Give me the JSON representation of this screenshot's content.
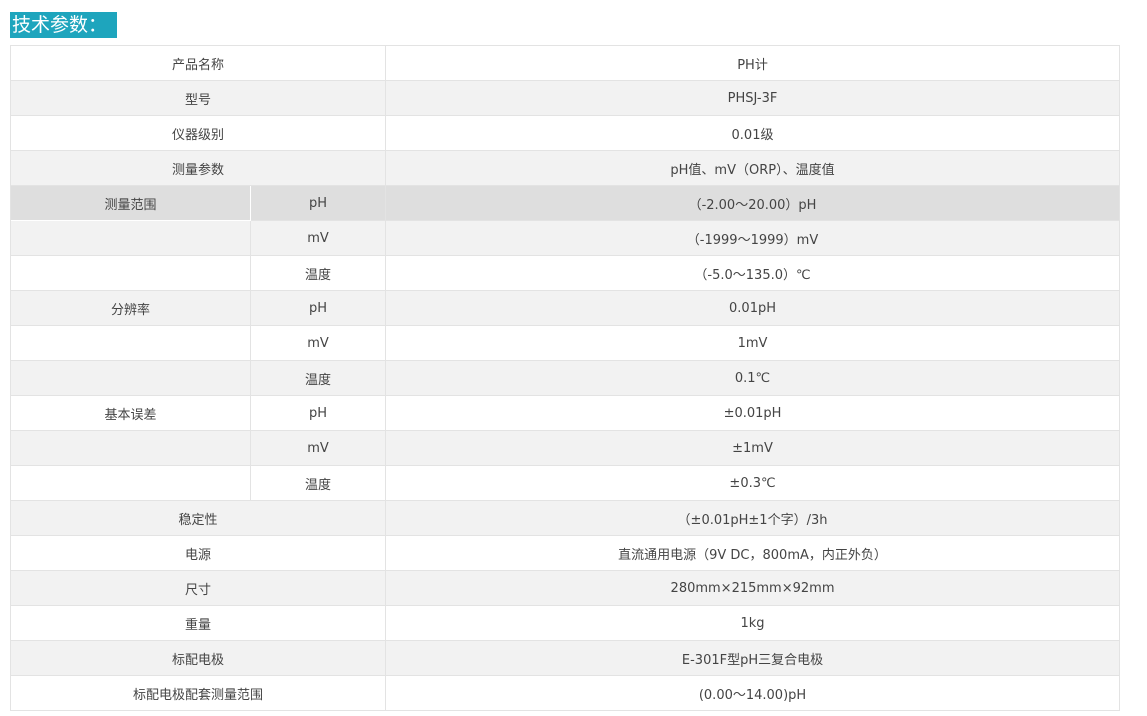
{
  "heading": "技术参数：",
  "rows": [
    {
      "label": "产品名称",
      "value": "PH计"
    },
    {
      "label": "型号",
      "value": "PHSJ-3F"
    },
    {
      "label": "仪器级别",
      "value": "0.01级"
    },
    {
      "label": "测量参数",
      "value": "pH值、mV（ORP）、温度值"
    },
    {
      "label": "测量范围",
      "sub": "pH",
      "value": "（-2.00～20.00）pH"
    },
    {
      "label": "",
      "sub": "mV",
      "value": "（-1999～1999）mV"
    },
    {
      "label": "",
      "sub": "温度",
      "value": "（-5.0～135.0）℃"
    },
    {
      "label": "分辨率",
      "sub": "pH",
      "value": "0.01pH"
    },
    {
      "label": "",
      "sub": "mV",
      "value": "1mV"
    },
    {
      "label": "",
      "sub": "温度",
      "value": "0.1℃"
    },
    {
      "label": "基本误差",
      "sub": "pH",
      "value": "±0.01pH"
    },
    {
      "label": "",
      "sub": "mV",
      "value": "±1mV"
    },
    {
      "label": "",
      "sub": "温度",
      "value": "±0.3℃"
    },
    {
      "label": "稳定性",
      "value": "（±0.01pH±1个字）/3h"
    },
    {
      "label": "电源",
      "value": "直流通用电源（9V DC，800mA，内正外负）"
    },
    {
      "label": "尺寸",
      "value": "280mm×215mm×92mm"
    },
    {
      "label": "重量",
      "value": "1kg"
    },
    {
      "label": "标配电极",
      "value": "E-301F型pH三复合电极"
    },
    {
      "label": "标配电极配套测量范围",
      "value": "(0.00～14.00)pH"
    }
  ]
}
